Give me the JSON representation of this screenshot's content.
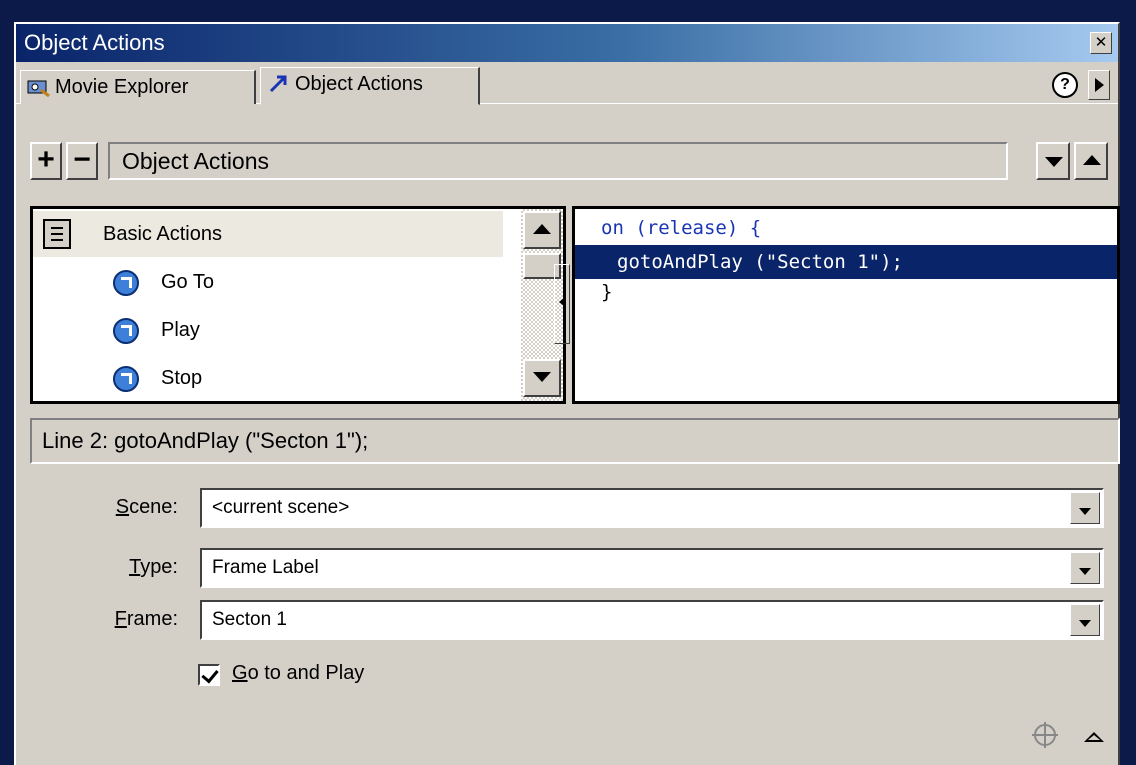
{
  "window": {
    "title": "Object Actions"
  },
  "tabs": [
    {
      "label": "Movie Explorer",
      "icon": "movie-explorer-icon"
    },
    {
      "label": "Object Actions",
      "icon": "object-actions-icon"
    }
  ],
  "toolbar": {
    "plus": "+",
    "minus": "−",
    "panel_label": "Object Actions"
  },
  "toolbox": {
    "category": "Basic Actions",
    "items": [
      {
        "label": "Go To"
      },
      {
        "label": "Play"
      },
      {
        "label": "Stop"
      }
    ]
  },
  "script": {
    "lines": [
      {
        "keyword": "on",
        "rest": " (release) {"
      },
      {
        "text": "gotoAndPlay (\"Secton 1\");"
      },
      {
        "text": "}"
      }
    ]
  },
  "status": {
    "text": "Line 2: gotoAndPlay (\"Secton 1\");"
  },
  "params": {
    "scene": {
      "label_key": "S",
      "label_rest": "cene:",
      "value": "<current scene>"
    },
    "type": {
      "label_key": "T",
      "label_rest": "ype:",
      "value": "Frame Label"
    },
    "frame": {
      "label_key": "F",
      "label_rest": "rame:",
      "value": "Secton 1"
    }
  },
  "checkbox": {
    "label_key": "G",
    "label_rest": "o to and Play",
    "checked": true
  },
  "colors": {
    "titlebar": "#0a246a",
    "selection": "#0a246a",
    "keyword": "#1a35b4",
    "panel": "#d4d0c8"
  }
}
